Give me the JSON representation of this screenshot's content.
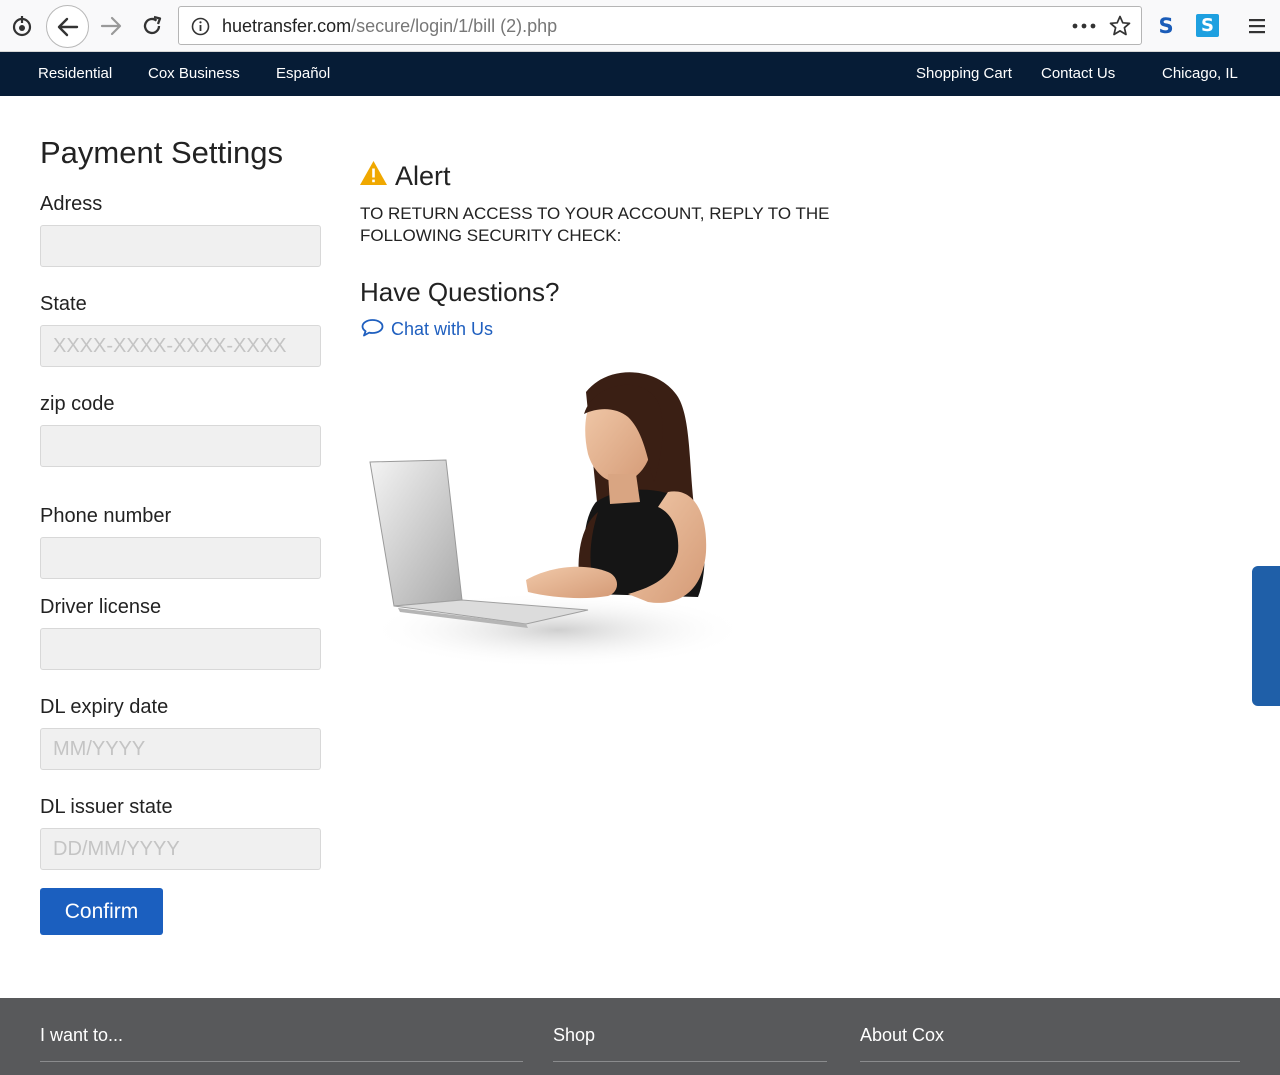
{
  "browser": {
    "url_host": "huetransfer.com",
    "url_path": "/secure/login/1/bill (2).php",
    "icons": [
      "sync-icon",
      "back-icon",
      "forward-icon",
      "reload-icon",
      "site-info-icon",
      "more-icon",
      "bookmark-star-icon",
      "extension-s-icon",
      "extension-skype-icon",
      "menu-icon"
    ]
  },
  "topnav": {
    "left": [
      "Residential",
      "Cox Business",
      "Español"
    ],
    "right": [
      "Shopping Cart",
      "Contact Us",
      "Chicago, IL"
    ]
  },
  "form": {
    "title": "Payment Settings",
    "fields": [
      {
        "label": "Adress",
        "placeholder": ""
      },
      {
        "label": "State",
        "placeholder": "XXXX-XXXX-XXXX-XXXX"
      },
      {
        "label": "zip code",
        "placeholder": ""
      },
      {
        "label": "Phone number",
        "placeholder": ""
      },
      {
        "label": "Driver license",
        "placeholder": ""
      },
      {
        "label": "DL expiry date",
        "placeholder": "MM/YYYY"
      },
      {
        "label": "DL issuer state",
        "placeholder": "DD/MM/YYYY"
      }
    ],
    "confirm_label": "Confirm"
  },
  "alert": {
    "title": "Alert",
    "text": "TO RETURN ACCESS TO YOUR ACCOUNT, REPLY TO THE FOLLOWING SECURITY CHECK:",
    "icon": "warning-icon",
    "color": "#f0a800"
  },
  "help": {
    "title": "Have Questions?",
    "chat_label": "Chat with Us",
    "chat_color": "#1f5fbf"
  },
  "footer": {
    "columns": [
      "I want to...",
      "Shop",
      "About Cox"
    ]
  },
  "colors": {
    "nav_bg": "#061c36",
    "footer_bg": "#58595b",
    "button": "#1b5fbf"
  }
}
